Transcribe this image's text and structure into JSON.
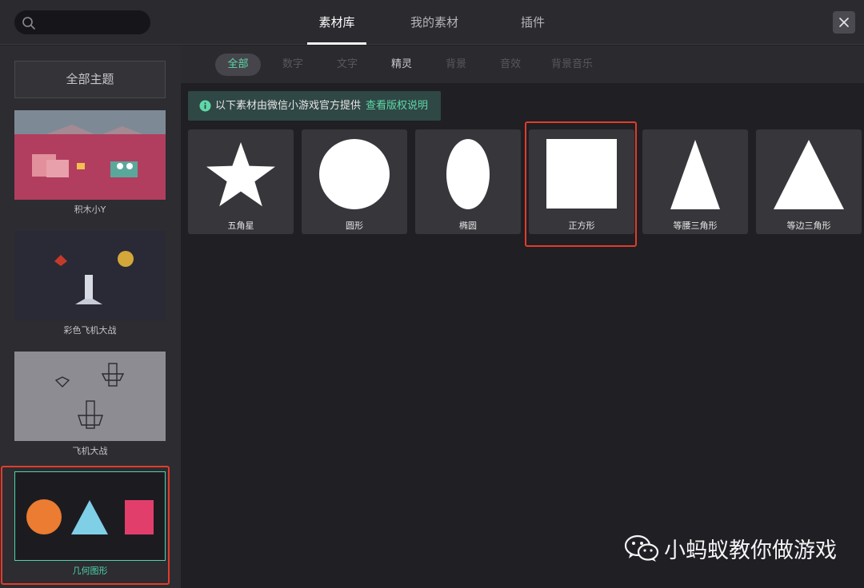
{
  "search": {
    "value": "",
    "placeholder": ""
  },
  "tabs": [
    {
      "label": "素材库",
      "active": true
    },
    {
      "label": "我的素材",
      "active": false
    },
    {
      "label": "插件",
      "active": false
    }
  ],
  "sidebar": {
    "all_label": "全部主题",
    "themes": [
      {
        "label": "积木小Y"
      },
      {
        "label": "彩色飞机大战"
      },
      {
        "label": "飞机大战"
      },
      {
        "label": "几何图形",
        "selected": true
      }
    ]
  },
  "categories": [
    {
      "label": "全部",
      "active": true
    },
    {
      "label": "数字"
    },
    {
      "label": "文字"
    },
    {
      "label": "精灵"
    },
    {
      "label": "背景"
    },
    {
      "label": "音效"
    },
    {
      "label": "背景音乐"
    }
  ],
  "notice": {
    "text": "以下素材由微信小游戏官方提供",
    "link": "查看版权说明"
  },
  "assets": [
    {
      "label": "五角星",
      "icon": "star-shape"
    },
    {
      "label": "圆形",
      "icon": "circle-shape"
    },
    {
      "label": "椭圆",
      "icon": "ellipse-shape"
    },
    {
      "label": "正方形",
      "icon": "square-shape",
      "highlighted": true
    },
    {
      "label": "等腰三角形",
      "icon": "isosceles-triangle-shape"
    },
    {
      "label": "等边三角形",
      "icon": "equilateral-triangle-shape"
    }
  ],
  "watermark": {
    "text": "小蚂蚁教你做游戏",
    "icon": "wechat-icon"
  },
  "colors": {
    "accent": "#5fd8a8",
    "highlight": "#e23c2a",
    "shape_orange": "#ec7c31",
    "shape_blue": "#7fcfe7",
    "shape_pink": "#e23e6c"
  }
}
